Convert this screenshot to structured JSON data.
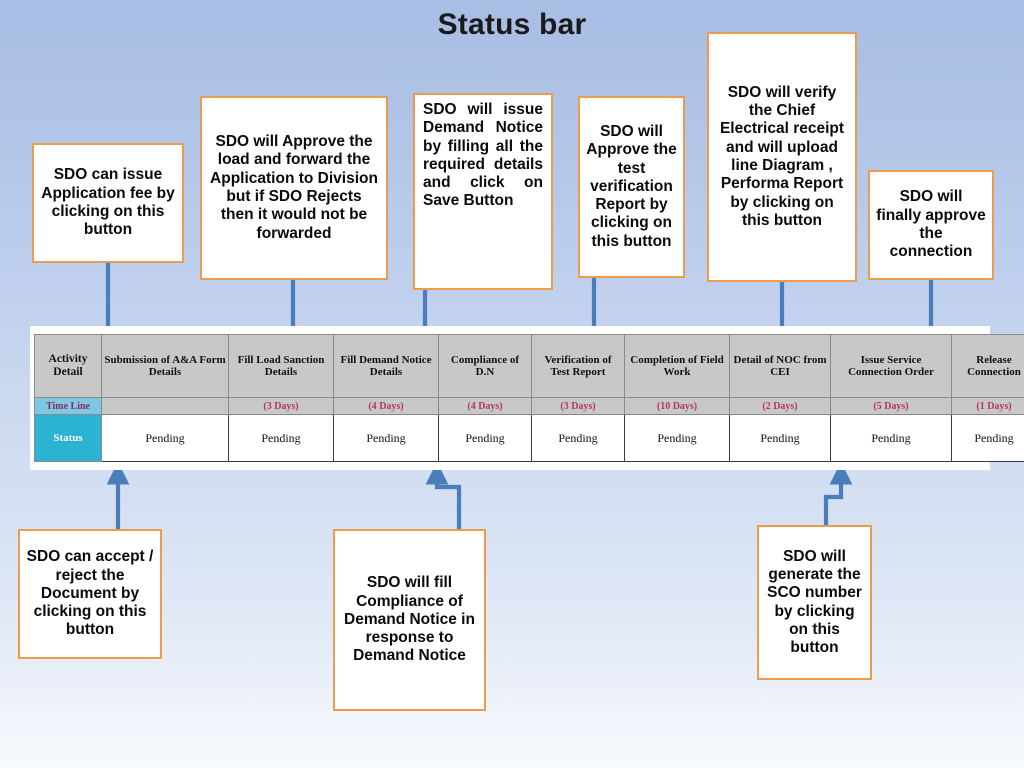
{
  "page": {
    "title": "Status bar",
    "accent_orange": "#ED9B4C",
    "connector_blue": "#4A7EBB",
    "header_gray": "#C8C8C8",
    "status_cyan": "#2BB3D4",
    "timeline_cyan": "#7EC8E3",
    "timeline_text": "#B03A5B"
  },
  "table": {
    "row_labels": {
      "activity": "Activity Detail",
      "timeline": "Time Line",
      "status": "Status"
    },
    "columns": [
      {
        "activity": "Submission of A&A Form Details",
        "timeline": "",
        "status": "Pending"
      },
      {
        "activity": "Fill Load Sanction Details",
        "timeline": "(3 Days)",
        "status": "Pending"
      },
      {
        "activity": "Fill Demand Notice Details",
        "timeline": "(4 Days)",
        "status": "Pending"
      },
      {
        "activity": "Compliance of D.N",
        "timeline": "(4 Days)",
        "status": "Pending"
      },
      {
        "activity": "Verification of Test Report",
        "timeline": "(3 Days)",
        "status": "Pending"
      },
      {
        "activity": "Completion of Field Work",
        "timeline": "(10 Days)",
        "status": "Pending"
      },
      {
        "activity": "Detail of NOC from CEI",
        "timeline": "(2 Days)",
        "status": "Pending"
      },
      {
        "activity": "Issue Service Connection Order",
        "timeline": "(5 Days)",
        "status": "Pending"
      },
      {
        "activity": "Release Connection",
        "timeline": "(1 Days)",
        "status": "Pending"
      }
    ]
  },
  "callouts": [
    {
      "id": "application-fee",
      "text": "SDO  can issue Application fee by clicking on this button"
    },
    {
      "id": "approve-load",
      "text": "SDO  will Approve the load and forward the Application to Division but if SDO Rejects then it would not be forwarded"
    },
    {
      "id": "issue-demand-notice",
      "text": "SDO  will issue Demand Notice by filling all the required details and click on Save Button"
    },
    {
      "id": "approve-test-report",
      "text": "SDO  will Approve the test verification Report  by clicking on this button"
    },
    {
      "id": "verify-cei-receipt",
      "text": "SDO  will verify the Chief Electrical receipt  and will upload line Diagram , Performa Report by clicking on this button"
    },
    {
      "id": "final-approve",
      "text": "SDO will finally approve the connection"
    },
    {
      "id": "accept-reject-doc",
      "text": "SDO  can accept / reject the Document by clicking on this button"
    },
    {
      "id": "fill-compliance-dn",
      "text": "SDO will fill Compliance of Demand Notice in response to Demand Notice"
    },
    {
      "id": "generate-sco",
      "text": "SDO will generate the SCO number by clicking on this button"
    }
  ]
}
